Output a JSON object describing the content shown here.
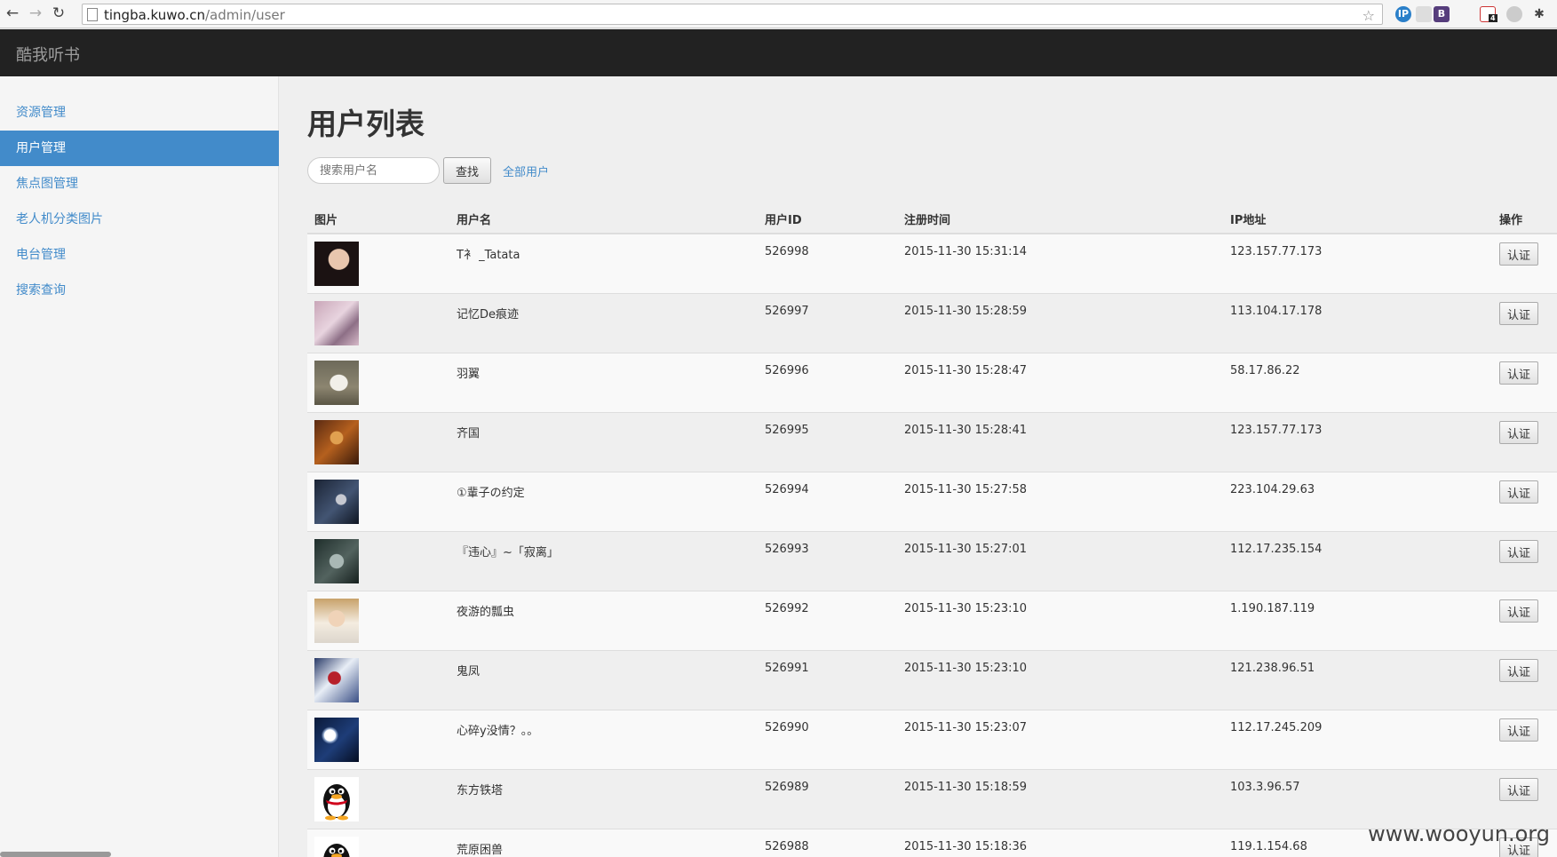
{
  "browser": {
    "url_host": "tingba.kuwo.cn",
    "url_path": "/admin/user",
    "extension_badge": "4"
  },
  "brand": "酷我听书",
  "sidebar": {
    "items": [
      {
        "label": "资源管理",
        "active": false
      },
      {
        "label": "用户管理",
        "active": true
      },
      {
        "label": "焦点图管理",
        "active": false
      },
      {
        "label": "老人机分类图片",
        "active": false
      },
      {
        "label": "电台管理",
        "active": false
      },
      {
        "label": "搜索查询",
        "active": false
      }
    ]
  },
  "main": {
    "title": "用户列表",
    "search": {
      "placeholder": "搜索用户名",
      "button": "查找",
      "all_link": "全部用户"
    },
    "table": {
      "headers": [
        "图片",
        "用户名",
        "用户ID",
        "注册时间",
        "IP地址",
        "操作"
      ],
      "rows": [
        {
          "name": "T衤 _Tatata",
          "id": "526998",
          "time": "2015-11-30 15:31:14",
          "ip": "123.157.77.173",
          "action": "认证",
          "avatar": "photo-girl"
        },
        {
          "name": "记忆De痕迹",
          "id": "526997",
          "time": "2015-11-30 15:28:59",
          "ip": "113.104.17.178",
          "action": "认证",
          "avatar": "photo-pink"
        },
        {
          "name": "羽翼",
          "id": "526996",
          "time": "2015-11-30 15:28:47",
          "ip": "58.17.86.22",
          "action": "认证",
          "avatar": "photo-dog"
        },
        {
          "name": "齐国",
          "id": "526995",
          "time": "2015-11-30 15:28:41",
          "ip": "123.157.77.173",
          "action": "认证",
          "avatar": "photo-warrior"
        },
        {
          "name": "①輩子の约定",
          "id": "526994",
          "time": "2015-11-30 15:27:58",
          "ip": "223.104.29.63",
          "action": "认证",
          "avatar": "photo-anime-dark"
        },
        {
          "name": "『违心』~「寂离」",
          "id": "526993",
          "time": "2015-11-30 15:27:01",
          "ip": "112.17.235.154",
          "action": "认证",
          "avatar": "photo-wolf"
        },
        {
          "name": "夜游的瓢虫",
          "id": "526992",
          "time": "2015-11-30 15:23:10",
          "ip": "1.190.187.119",
          "action": "认证",
          "avatar": "photo-boy"
        },
        {
          "name": "鬼凤",
          "id": "526991",
          "time": "2015-11-30 15:23:10",
          "ip": "121.238.96.51",
          "action": "认证",
          "avatar": "photo-anime-red"
        },
        {
          "name": "心碎y没情？。。",
          "id": "526990",
          "time": "2015-11-30 15:23:07",
          "ip": "112.17.245.209",
          "action": "认证",
          "avatar": "photo-moon"
        },
        {
          "name": "东方铁塔",
          "id": "526989",
          "time": "2015-11-30 15:18:59",
          "ip": "103.3.96.57",
          "action": "认证",
          "avatar": "qq-penguin"
        },
        {
          "name": "荒原困兽",
          "id": "526988",
          "time": "2015-11-30 15:18:36",
          "ip": "119.1.154.68",
          "action": "认证",
          "avatar": "qq-penguin"
        }
      ]
    }
  },
  "watermark": "www.wooyun.org"
}
